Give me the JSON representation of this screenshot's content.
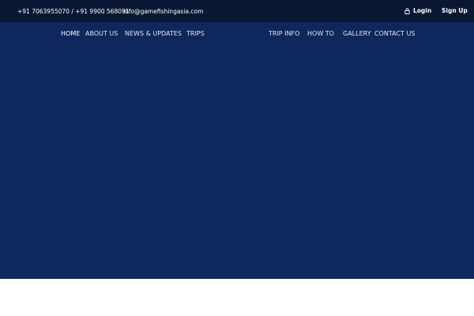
{
  "topbar": {
    "phone": "+91 7063955070 / +91 9900 568091",
    "email": "info@gamefishingasia.com",
    "login_label": "Login",
    "signup_label": "Sign Up",
    "login_icon": "lock-icon"
  },
  "nav": {
    "items": [
      {
        "label": "HOME",
        "active": true
      },
      {
        "label": "ABOUT US"
      },
      {
        "label": "NEWS & UPDATES"
      },
      {
        "label": "TRIPS"
      },
      {
        "label": "TRIP INFO"
      },
      {
        "label": "HOW TO"
      },
      {
        "label": "GALLERY"
      },
      {
        "label": "CONTACT US"
      }
    ]
  },
  "colors": {
    "topbar_bg": "#0a1733",
    "hero_bg": "#0e275c",
    "page_bg": "#ffffff"
  }
}
